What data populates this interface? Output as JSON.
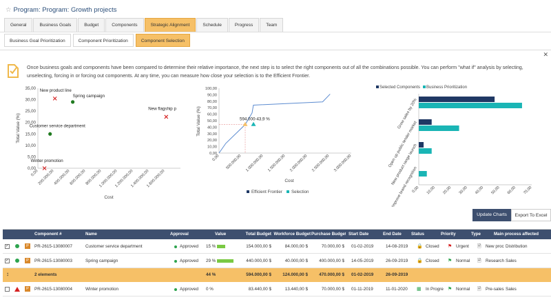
{
  "title": "Program: Program: Growth projects",
  "tabs": [
    "General",
    "Business Goals",
    "Budget",
    "Components",
    "Strategic Alignment",
    "Schedule",
    "Progress",
    "Team"
  ],
  "active_tab": "Strategic Alignment",
  "subtabs": [
    "Business Goal Prioritization",
    "Component Prioritization",
    "Component Selection"
  ],
  "active_subtab": "Component Selection",
  "description": "Once business goals and components have been compared to determine their relative importance, the next step is to select the right components out of all the combinations possible. You can perform \"what if\" analysis by selecting, unselecting, forcing in or forcing out components. At any time, you can measure how close your selection is to the Efficient Frontier.",
  "buttons": {
    "update": "Update Charts",
    "export": "Export To Excel"
  },
  "colors": {
    "accent": "#f6c067",
    "header": "#3d4f6f",
    "navy": "#1f3864",
    "teal": "#1ab5b5",
    "green_dot": "#2da44e",
    "red": "#d52020"
  },
  "chart_data": [
    {
      "type": "scatter",
      "xlabel": "Cost",
      "ylabel": "Total Value (%)",
      "xlim": [
        0,
        1800000
      ],
      "ylim": [
        0,
        35
      ],
      "x_ticks": [
        "0,00",
        "200.000,00",
        "400.000,00",
        "600.000,00",
        "800.000,00",
        "1.000.000,00",
        "1.200.000,00",
        "1.400.000,00",
        "1.600.000,00"
      ],
      "y_ticks": [
        "0,00",
        "5,00",
        "10,00",
        "15,00",
        "20,00",
        "25,00",
        "30,00",
        "35,00"
      ],
      "points": [
        {
          "label": "New product line",
          "x": 215000,
          "y": 30.5,
          "marker": "x",
          "color": "#d52020"
        },
        {
          "label": "Spring campaign",
          "x": 440000,
          "y": 29,
          "marker": "dot",
          "color": "#1f7a1f"
        },
        {
          "label": "Customer service department",
          "x": 154000,
          "y": 15,
          "marker": "dot",
          "color": "#1f7a1f"
        },
        {
          "label": "Winter promotion",
          "x": 83440,
          "y": 0,
          "marker": "x",
          "color": "#d52020"
        },
        {
          "label": "New flagship p",
          "x": 1620000,
          "y": 22.5,
          "marker": "x",
          "color": "#d52020"
        }
      ]
    },
    {
      "type": "line",
      "xlabel": "Cost",
      "ylabel": "Total Value (%)",
      "xlim": [
        0,
        3000000
      ],
      "ylim": [
        0,
        100
      ],
      "x_ticks": [
        "0,00",
        "500.000,00",
        "1.000.000,00",
        "1.500.000,00",
        "2.000.000,00",
        "2.500.000,00",
        "3.000.000,00"
      ],
      "y_ticks": [
        "0,00",
        "10,00",
        "20,00",
        "30,00",
        "40,00",
        "50,00",
        "60,00",
        "70,00",
        "80,00",
        "90,00",
        "100,00"
      ],
      "series": [
        {
          "name": "Efficient Frontier",
          "color": "#5b8bd0",
          "points": [
            [
              0,
              0
            ],
            [
              154000,
              15
            ],
            [
              594000,
              44
            ],
            [
              750000,
              62
            ],
            [
              780000,
              74
            ],
            [
              2350000,
              79
            ],
            [
              2520000,
              91
            ]
          ]
        },
        {
          "name": "Selection",
          "color": "#1ab5b5",
          "points": [
            [
              594000,
              43.9
            ]
          ]
        }
      ],
      "annotation": "594.000-43,9 %"
    },
    {
      "type": "bar",
      "orientation": "horizontal",
      "categories": [
        "Grow sales by 20%",
        "Open up public tender market",
        "New product range launch",
        "Improve brand recognition"
      ],
      "series": [
        {
          "name": "Selected Components",
          "color": "#1f3864",
          "values": [
            47,
            8,
            3,
            0
          ]
        },
        {
          "name": "Business Prioritization",
          "color": "#1ab5b5",
          "values": [
            64,
            25,
            8,
            5
          ]
        }
      ],
      "xlim": [
        0,
        70
      ],
      "x_ticks": [
        "0,00",
        "10,00",
        "20,00",
        "30,00",
        "40,00",
        "50,00",
        "60,00",
        "70,00"
      ]
    }
  ],
  "table": {
    "headers": [
      "Component #",
      "Name",
      "Approval",
      "Value",
      "Total Budget",
      "Workforce Budget",
      "Purchase Budget",
      "Start Date",
      "End Date",
      "Status",
      "Priority",
      "Type",
      "Main process affected"
    ],
    "rows": [
      {
        "checked": true,
        "marker": "dot",
        "id": "PR-2615-13080007",
        "name": "Customer service department",
        "approval": "Approved",
        "value": "15 %",
        "value_pct": 15,
        "total": "154.000,00 $",
        "workforce": "84.000,00 $",
        "purchase": "70.000,00 $",
        "start": "01-02-2019",
        "end": "14-08-2019",
        "status": "Closed",
        "priority": "Urgent",
        "type": "New proc",
        "process": "Distribution"
      },
      {
        "checked": true,
        "marker": "dot",
        "id": "PR-2615-13080003",
        "name": "Spring campaign",
        "approval": "Approved",
        "value": "29 %",
        "value_pct": 29,
        "total": "440.000,00 $",
        "workforce": "40.000,00 $",
        "purchase": "400.000,00 $",
        "start": "14-05-2019",
        "end": "26-09-2019",
        "status": "Closed",
        "priority": "Normal",
        "type": "Research",
        "process": "Sales"
      }
    ],
    "summary": {
      "label": "2 elements",
      "value": "44 %",
      "total": "594.000,00 $",
      "workforce": "124.000,00 $",
      "purchase": "470.000,00 $",
      "start": "01-02-2019",
      "end": "26-09-2019"
    },
    "extra_rows": [
      {
        "checked": false,
        "marker": "triangle",
        "id": "PR-2615-13080004",
        "name": "Winter promotion",
        "approval": "Approved",
        "value": "0 %",
        "value_pct": 0,
        "total": "83.440,00 $",
        "workforce": "13.440,00 $",
        "purchase": "70.000,00 $",
        "start": "01-11-2019",
        "end": "11-01-2020",
        "status": "In Progre",
        "priority": "Normal",
        "type": "Pre-sales",
        "process": "Sales"
      }
    ]
  }
}
